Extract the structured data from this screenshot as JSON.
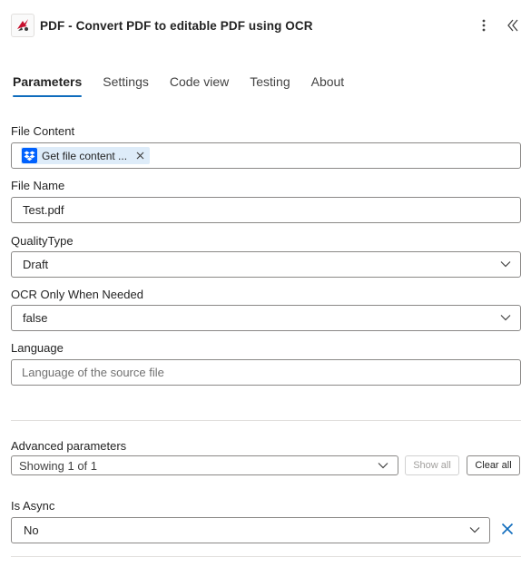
{
  "header": {
    "title": "PDF - Convert PDF to editable PDF using OCR",
    "app_icon": "pdf-bird-logo-icon",
    "more_icon": "more-vertical-icon",
    "collapse_icon": "double-chevron-left-icon"
  },
  "tabs": [
    {
      "label": "Parameters",
      "active": true
    },
    {
      "label": "Settings",
      "active": false
    },
    {
      "label": "Code view",
      "active": false
    },
    {
      "label": "Testing",
      "active": false
    },
    {
      "label": "About",
      "active": false
    }
  ],
  "fields": {
    "file_content": {
      "label": "File Content",
      "token_label": "Get file content ...",
      "token_icon": "dropbox-icon"
    },
    "file_name": {
      "label": "File Name",
      "value": "Test.pdf"
    },
    "quality_type": {
      "label": "QualityType",
      "value": "Draft"
    },
    "ocr_only": {
      "label": "OCR Only When Needed",
      "value": "false"
    },
    "language": {
      "label": "Language",
      "placeholder": "Language of the source file"
    }
  },
  "advanced": {
    "label": "Advanced parameters",
    "select_value": "Showing 1 of 1",
    "show_all": "Show all",
    "clear_all": "Clear all"
  },
  "is_async": {
    "label": "Is Async",
    "value": "No"
  },
  "colors": {
    "accent": "#0f6cbd",
    "token_bg": "#deecf9",
    "dropbox": "#0061fe",
    "logo_red": "#c8102e"
  }
}
